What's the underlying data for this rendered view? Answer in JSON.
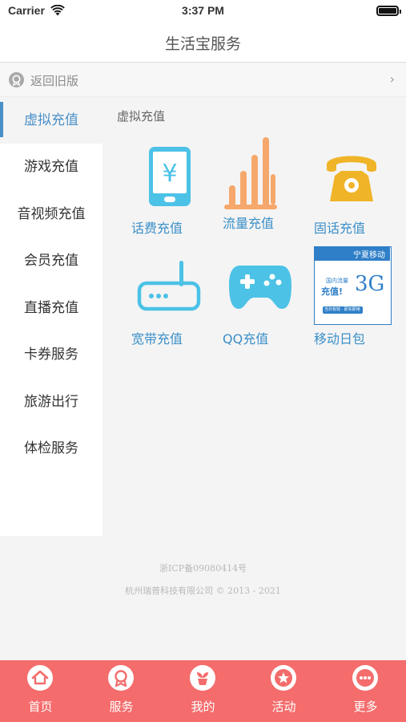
{
  "status_bar": {
    "carrier": "Carrier",
    "time": "3:37 PM"
  },
  "nav": {
    "title": "生活宝服务"
  },
  "back_row": {
    "label": "返回旧版",
    "chevron": "›"
  },
  "sidebar": {
    "items": [
      {
        "label": "虚拟充值",
        "active": true
      },
      {
        "label": "游戏充值"
      },
      {
        "label": "音视频充值"
      },
      {
        "label": "会员充值"
      },
      {
        "label": "直播充值"
      },
      {
        "label": "卡券服务"
      },
      {
        "label": "旅游出行"
      },
      {
        "label": "体检服务"
      }
    ]
  },
  "content": {
    "section_title": "虚拟充值",
    "tiles": [
      {
        "label": "话费充值",
        "icon": "phone-bill-icon"
      },
      {
        "label": "流量充值",
        "icon": "bar-chart-icon"
      },
      {
        "label": "固话充值",
        "icon": "telephone-icon"
      },
      {
        "label": "宽带充值",
        "icon": "router-icon"
      },
      {
        "label": "QQ充值",
        "icon": "gamepad-icon"
      },
      {
        "label": "移动日包",
        "icon": "mobile-daily-pack-card"
      }
    ],
    "card": {
      "header": "宁夏移动",
      "line1": "国内流量",
      "line2": "充值!",
      "big": "3G",
      "footer": "当日有效 · 即买即用"
    }
  },
  "footer": {
    "icp": "浙ICP备09080414号",
    "company": "杭州瑞普科技有限公司 © 2013 - 2021"
  },
  "tabbar": {
    "tabs": [
      {
        "label": "首页",
        "icon": "home-icon"
      },
      {
        "label": "服务",
        "icon": "service-icon"
      },
      {
        "label": "我的",
        "icon": "plant-icon"
      },
      {
        "label": "活动",
        "icon": "star-icon"
      },
      {
        "label": "更多",
        "icon": "more-icon"
      }
    ]
  },
  "colors": {
    "accent_blue": "#4a90c8",
    "tabbar_red": "#f46c6c",
    "icon_cyan": "#4cc2e6",
    "icon_orange": "#f6a86c",
    "icon_yellow": "#f0b428"
  }
}
